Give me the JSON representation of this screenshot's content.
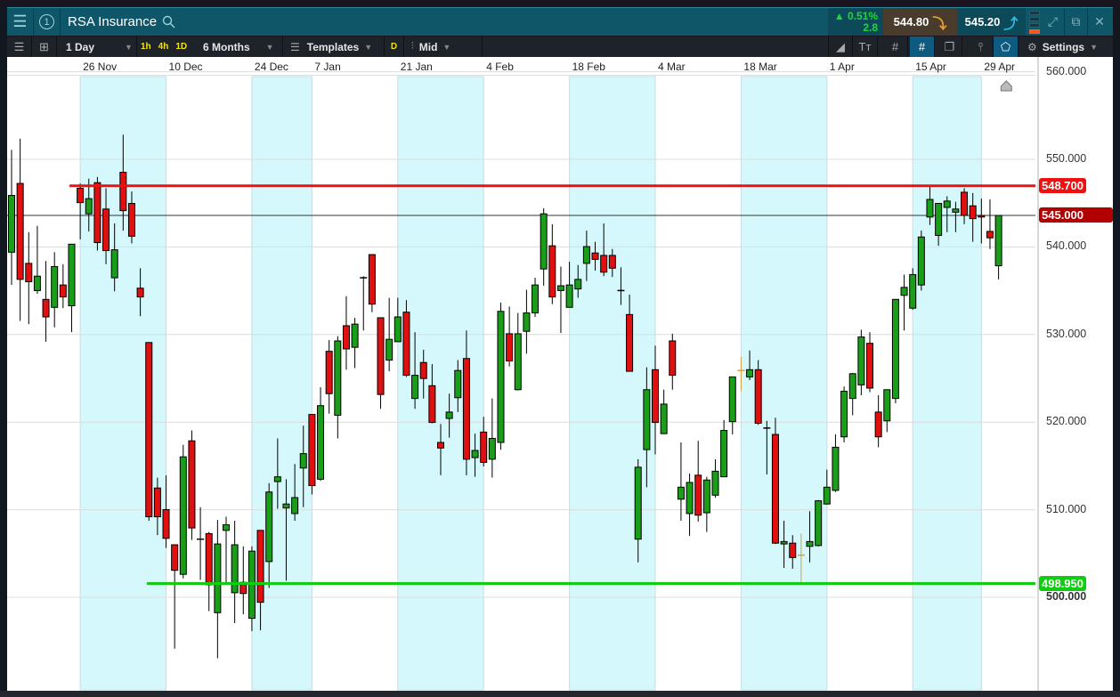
{
  "header": {
    "instrument": "RSA Insurance",
    "layout_number": "1",
    "change_percent": "0.51%",
    "change_value": "2.8",
    "sell_price": "544.80",
    "buy_price": "545.20",
    "signal_level": 1
  },
  "toolbar": {
    "interval": "1 Day",
    "quick_intervals": [
      "1h",
      "4h",
      "1D"
    ],
    "period": "6 Months",
    "templates_label": "Templates",
    "d_label": "D",
    "price_type": "Mid",
    "settings_label": "Settings"
  },
  "colors": {
    "up": "#1a9e1a",
    "down": "#e01010",
    "neutral": "#d9a040",
    "resistance": "#ee1111",
    "support": "#11cc11",
    "current": "#b00000",
    "band": "#d4f8fb"
  },
  "chart_data": {
    "type": "candlestick",
    "title": "RSA Insurance",
    "x_labels": [
      {
        "label": "26 Nov",
        "index": 8
      },
      {
        "label": "10 Dec",
        "index": 18
      },
      {
        "label": "24 Dec",
        "index": 28
      },
      {
        "label": "7 Jan",
        "index": 35
      },
      {
        "label": "21 Jan",
        "index": 45
      },
      {
        "label": "4 Feb",
        "index": 55
      },
      {
        "label": "18 Feb",
        "index": 65
      },
      {
        "label": "4 Mar",
        "index": 75
      },
      {
        "label": "18 Mar",
        "index": 85
      },
      {
        "label": "1 Apr",
        "index": 95
      },
      {
        "label": "15 Apr",
        "index": 105
      },
      {
        "label": "29 Apr",
        "index": 113
      }
    ],
    "shaded_ranges": [
      [
        8,
        18
      ],
      [
        28,
        35
      ],
      [
        45,
        55
      ],
      [
        65,
        75
      ],
      [
        85,
        95
      ],
      [
        105,
        113
      ]
    ],
    "y_ticks": [
      "560.000",
      "550.000",
      "540.000",
      "530.000",
      "520.000",
      "510.000",
      "500.000"
    ],
    "y_tick_values": [
      560,
      550,
      540,
      530,
      520,
      510,
      500
    ],
    "horizontal_lines": [
      {
        "name": "resistance",
        "value": 548.7,
        "label": "548.700",
        "start_index": 8
      },
      {
        "name": "support",
        "value": 498.95,
        "label": "498.950",
        "start_index": 17
      }
    ],
    "current_price": {
      "value": 545.0,
      "label": "545.000"
    },
    "neutral_indices": [
      85,
      92
    ],
    "ohlc": [
      [
        540.4,
        553.2,
        536.3,
        547.5
      ],
      [
        549.0,
        554.6,
        531.8,
        537.0
      ],
      [
        539.0,
        542.9,
        531.4,
        536.7
      ],
      [
        535.6,
        543.7,
        535.2,
        537.4
      ],
      [
        534.5,
        539.3,
        529.2,
        532.3
      ],
      [
        533.5,
        540.4,
        531.0,
        538.6
      ],
      [
        536.3,
        538.9,
        533.4,
        534.8
      ],
      [
        533.7,
        541.4,
        530.4,
        541.4
      ],
      [
        548.4,
        549.0,
        542.0,
        546.6
      ],
      [
        545.2,
        549.6,
        543.0,
        547.1
      ],
      [
        549.1,
        549.8,
        540.6,
        541.6
      ],
      [
        545.8,
        548.4,
        538.9,
        540.6
      ],
      [
        537.2,
        544.0,
        535.5,
        540.7
      ],
      [
        550.4,
        555.1,
        543.1,
        545.6
      ],
      [
        546.5,
        548.0,
        541.5,
        542.4
      ],
      [
        535.9,
        538.4,
        532.4,
        534.8
      ],
      [
        529.1,
        529.1,
        506.8,
        507.3
      ],
      [
        510.9,
        512.2,
        505.0,
        507.3
      ],
      [
        508.2,
        512.5,
        503.4,
        504.6
      ],
      [
        503.8,
        503.8,
        490.8,
        500.6
      ],
      [
        500.1,
        516.3,
        499.6,
        514.8
      ],
      [
        516.8,
        518.1,
        504.4,
        505.9
      ],
      [
        504.5,
        508.5,
        499.4,
        504.5
      ],
      [
        505.2,
        505.4,
        495.5,
        498.8
      ],
      [
        495.3,
        506.9,
        489.6,
        503.9
      ],
      [
        505.6,
        507.3,
        498.8,
        506.3
      ],
      [
        497.8,
        506.8,
        494.0,
        503.8
      ],
      [
        499.1,
        503.6,
        495.1,
        497.7
      ],
      [
        494.6,
        503.6,
        493.0,
        503.0
      ],
      [
        505.6,
        505.6,
        493.1,
        496.6
      ],
      [
        501.7,
        511.5,
        498.4,
        510.4
      ],
      [
        511.7,
        517.1,
        508.3,
        512.3
      ],
      [
        508.4,
        512.0,
        499.3,
        508.9
      ],
      [
        507.7,
        513.9,
        506.8,
        509.7
      ],
      [
        513.4,
        518.7,
        508.5,
        515.2
      ],
      [
        520.1,
        520.1,
        510.1,
        511.2
      ],
      [
        512.0,
        523.5,
        511.8,
        521.2
      ],
      [
        528.0,
        529.4,
        520.2,
        522.7
      ],
      [
        520.0,
        529.9,
        517.1,
        529.3
      ],
      [
        531.2,
        534.9,
        525.7,
        528.3
      ],
      [
        528.5,
        532.2,
        525.9,
        531.4
      ],
      [
        537.2,
        537.4,
        530.6,
        537.2
      ],
      [
        540.1,
        540.1,
        532.9,
        533.9
      ],
      [
        532.2,
        532.2,
        520.8,
        522.6
      ],
      [
        526.9,
        534.7,
        525.5,
        529.5
      ],
      [
        529.2,
        534.7,
        529.2,
        532.3
      ],
      [
        532.9,
        534.4,
        524.8,
        525.0
      ],
      [
        522.1,
        530.4,
        520.8,
        525.0
      ],
      [
        526.6,
        528.2,
        522.1,
        524.6
      ],
      [
        523.7,
        526.4,
        519.0,
        519.1
      ],
      [
        516.6,
        518.9,
        512.5,
        515.9
      ],
      [
        519.6,
        522.7,
        517.2,
        520.4
      ],
      [
        522.2,
        526.9,
        520.4,
        525.6
      ],
      [
        527.1,
        530.6,
        512.5,
        514.5
      ],
      [
        514.7,
        517.7,
        512.3,
        515.6
      ],
      [
        517.9,
        519.8,
        513.6,
        514.1
      ],
      [
        514.5,
        522.1,
        512.2,
        517.1
      ],
      [
        516.6,
        534.1,
        515.7,
        533.0
      ],
      [
        530.2,
        533.6,
        526.1,
        526.8
      ],
      [
        523.2,
        532.8,
        523.1,
        530.2
      ],
      [
        530.5,
        535.7,
        527.7,
        532.8
      ],
      [
        532.8,
        537.2,
        532.3,
        536.3
      ],
      [
        538.3,
        545.9,
        536.2,
        545.2
      ],
      [
        541.2,
        543.9,
        533.9,
        534.8
      ],
      [
        535.6,
        538.6,
        530.3,
        536.2
      ],
      [
        533.5,
        539.2,
        533.5,
        536.3
      ],
      [
        535.8,
        538.8,
        534.7,
        537.0
      ],
      [
        539.0,
        543.1,
        536.8,
        541.1
      ],
      [
        540.3,
        541.7,
        538.1,
        539.5
      ],
      [
        540.0,
        544.0,
        537.4,
        537.9
      ],
      [
        540.0,
        540.8,
        537.3,
        538.4
      ],
      [
        535.6,
        538.5,
        533.8,
        535.6
      ],
      [
        532.6,
        535.1,
        525.5,
        525.5
      ],
      [
        504.5,
        514.5,
        501.6,
        513.5
      ],
      [
        515.7,
        526.0,
        511.0,
        523.2
      ],
      [
        525.7,
        528.7,
        515.1,
        519.1
      ],
      [
        517.7,
        523.2,
        517.7,
        521.4
      ],
      [
        529.3,
        530.2,
        523.2,
        525.0
      ],
      [
        509.5,
        516.6,
        506.8,
        511.0
      ],
      [
        507.7,
        512.7,
        504.9,
        511.6
      ],
      [
        512.5,
        516.8,
        506.7,
        507.5
      ],
      [
        507.8,
        512.3,
        505.4,
        511.9
      ],
      [
        510.0,
        514.5,
        509.7,
        513.0
      ],
      [
        512.3,
        519.4,
        512.3,
        518.1
      ],
      [
        519.2,
        524.8,
        517.6,
        524.8
      ],
      [
        525.6,
        527.3,
        523.0,
        525.6
      ],
      [
        524.8,
        528.1,
        524.4,
        525.7
      ],
      [
        525.7,
        526.9,
        518.8,
        519.0
      ],
      [
        518.4,
        519.3,
        512.6,
        518.4
      ],
      [
        517.6,
        519.7,
        503.9,
        504.0
      ],
      [
        503.9,
        506.8,
        500.9,
        504.2
      ],
      [
        504.0,
        505.0,
        500.8,
        502.2
      ],
      [
        502.5,
        505.2,
        498.95,
        502.5
      ],
      [
        503.6,
        508.0,
        501.6,
        504.2
      ],
      [
        503.7,
        509.4,
        503.6,
        509.3
      ],
      [
        508.9,
        513.2,
        508.8,
        511.0
      ],
      [
        510.6,
        517.6,
        510.4,
        516.0
      ],
      [
        517.3,
        523.6,
        516.6,
        523.0
      ],
      [
        522.1,
        525.3,
        520.0,
        525.2
      ],
      [
        523.8,
        530.7,
        522.5,
        529.8
      ],
      [
        529.0,
        530.4,
        522.9,
        523.4
      ],
      [
        520.4,
        522.5,
        516.0,
        517.3
      ],
      [
        519.3,
        523.2,
        517.9,
        523.2
      ],
      [
        522.1,
        534.5,
        521.5,
        534.5
      ],
      [
        535.0,
        537.6,
        530.6,
        536.0
      ],
      [
        533.4,
        538.4,
        533.2,
        537.6
      ],
      [
        536.3,
        543.1,
        535.6,
        542.3
      ],
      [
        544.8,
        548.7,
        543.8,
        547.0
      ],
      [
        542.5,
        546.5,
        541.2,
        546.5
      ],
      [
        546.0,
        547.4,
        542.9,
        546.8
      ],
      [
        545.4,
        546.7,
        542.9,
        545.8
      ],
      [
        547.9,
        548.4,
        543.9,
        545.0
      ],
      [
        546.2,
        547.8,
        541.7,
        544.6
      ],
      [
        545.0,
        547.1,
        541.5,
        544.8
      ],
      [
        543.0,
        547.0,
        540.8,
        542.2
      ],
      [
        538.7,
        545.0,
        537.0,
        545.0
      ]
    ]
  }
}
